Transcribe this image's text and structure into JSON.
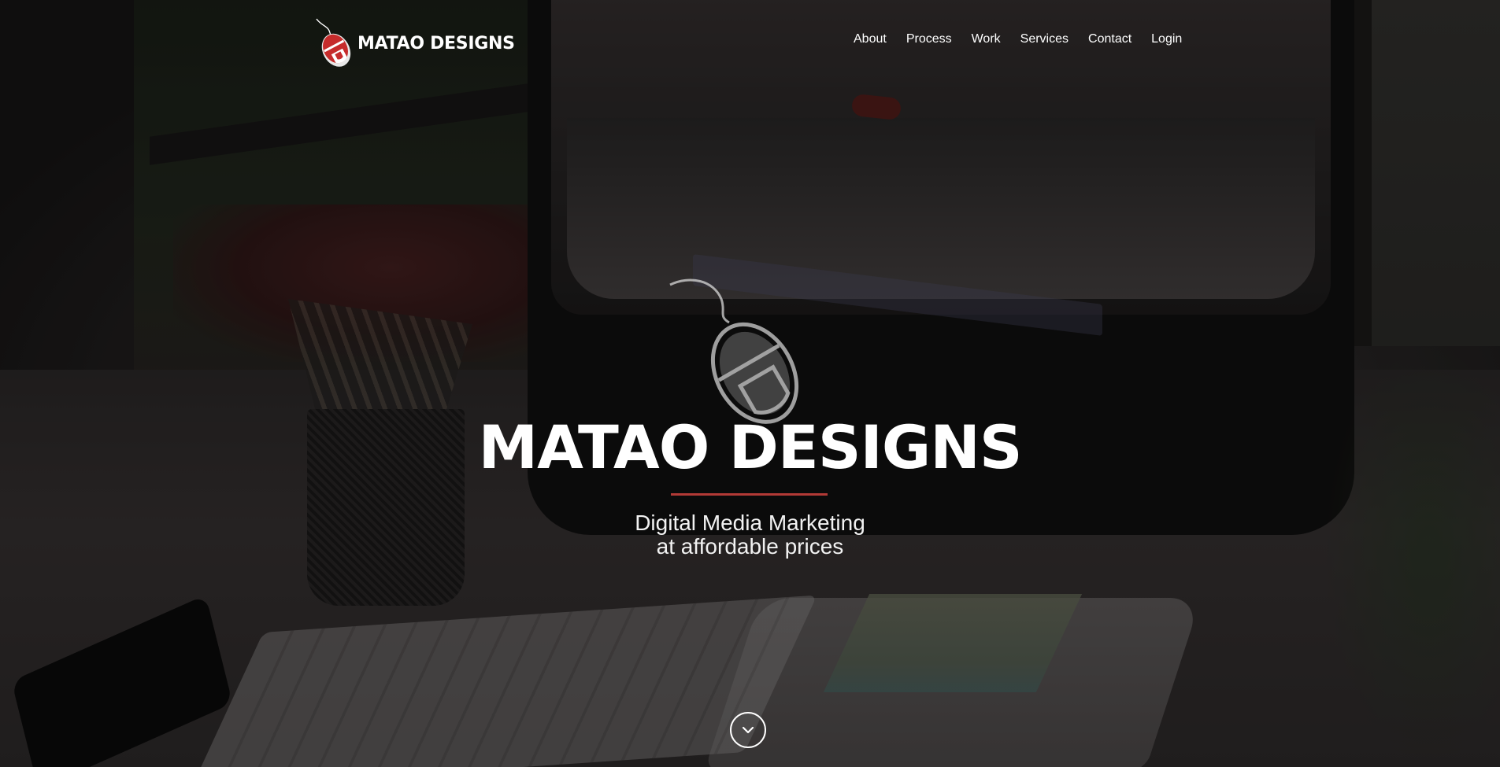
{
  "brand": {
    "name": "MATAO DESIGNS",
    "logo_icon": "computer-mouse-logo-icon"
  },
  "nav": {
    "items": [
      {
        "label": "About"
      },
      {
        "label": "Process"
      },
      {
        "label": "Work"
      },
      {
        "label": "Services"
      },
      {
        "label": "Contact"
      },
      {
        "label": "Login"
      }
    ]
  },
  "hero": {
    "title": "MATAO DESIGNS",
    "subtitle_line1": "Digital Media Marketing",
    "subtitle_line2": "at affordable prices",
    "scroll_icon": "chevron-down-icon"
  },
  "colors": {
    "accent": "#b23a36",
    "text": "#ffffff"
  }
}
